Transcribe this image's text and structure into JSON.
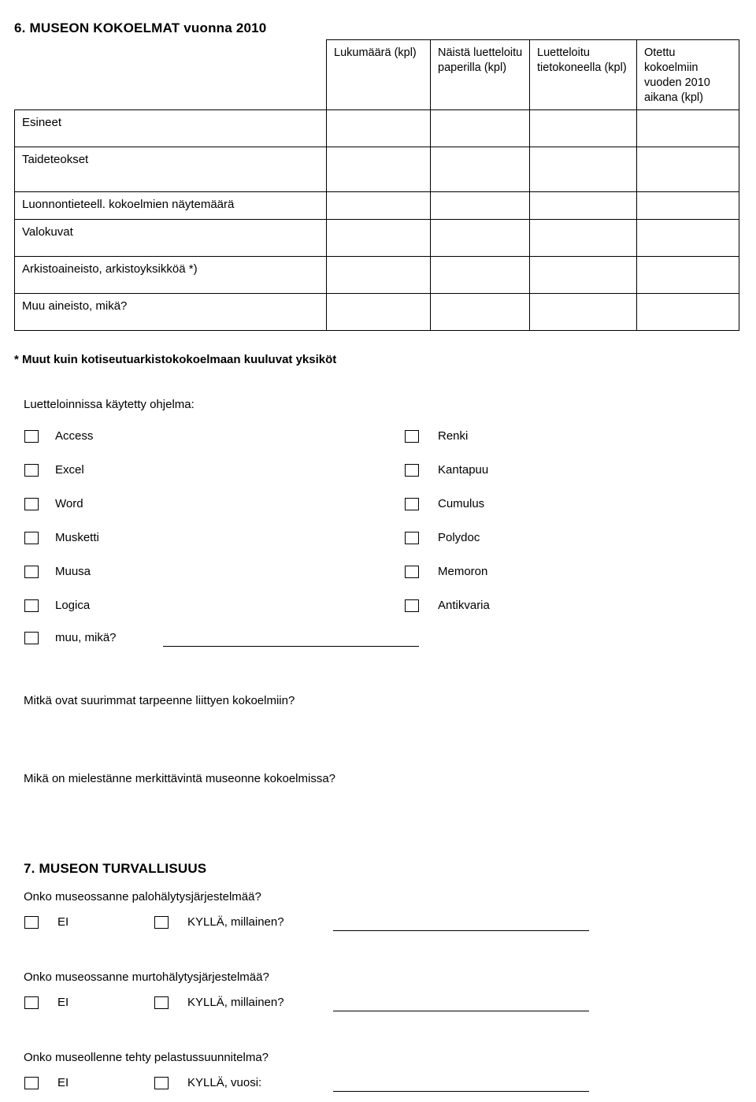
{
  "section6": {
    "title": "6. MUSEON KOKOELMAT vuonna 2010",
    "table": {
      "headers": [
        "",
        "Lukumäärä (kpl)",
        "Näistä luetteloitu paperilla (kpl)",
        "Luetteloitu tietokoneella (kpl)",
        "Otettu kokoelmiin vuoden 2010 aikana (kpl)"
      ],
      "rows": [
        {
          "label": "Esineet",
          "values": [
            "",
            "",
            "",
            ""
          ]
        },
        {
          "label": "Taideteokset",
          "values": [
            "",
            "",
            "",
            ""
          ]
        },
        {
          "label": "Luonnontieteell. kokoelmien näytemäärä",
          "values": [
            "",
            "",
            "",
            ""
          ]
        },
        {
          "label": "Valokuvat",
          "values": [
            "",
            "",
            "",
            ""
          ]
        },
        {
          "label": "Arkistoaineisto, arkistoyksikköä *)",
          "values": [
            "",
            "",
            "",
            ""
          ]
        },
        {
          "label": "Muu aineisto, mikä?",
          "values": [
            "",
            "",
            "",
            ""
          ]
        }
      ]
    },
    "footnote": "* Muut kuin kotiseutuarkistokokoelmaan kuuluvat yksiköt",
    "program_question": "Luetteloinnissa käytetty ohjelma:",
    "programs_left": [
      "Access",
      "Excel",
      "Word",
      "Musketti",
      "Muusa",
      "Logica"
    ],
    "programs_right": [
      "Renki",
      "Kantapuu",
      "Cumulus",
      "Polydoc",
      "Memoron",
      "Antikvaria"
    ],
    "other_program_label": "muu, mikä?",
    "question_needs": "Mitkä ovat suurimmat tarpeenne liittyen kokoelmiin?",
    "question_significant": "Mikä on mielestänne merkittävintä museonne kokoelmissa?"
  },
  "section7": {
    "title": "7. MUSEON TURVALLISUUS",
    "questions": [
      {
        "text": "Onko museossanne palohälytysjärjestelmää?",
        "no_label": "EI",
        "yes_label": "KYLLÄ, millainen?"
      },
      {
        "text": "Onko museossanne murtohälytysjärjestelmää?",
        "no_label": "EI",
        "yes_label": "KYLLÄ, millainen?"
      },
      {
        "text": "Onko museollenne tehty pelastussuunnitelma?",
        "no_label": "EI",
        "yes_label": "KYLLÄ, vuosi:"
      }
    ]
  }
}
